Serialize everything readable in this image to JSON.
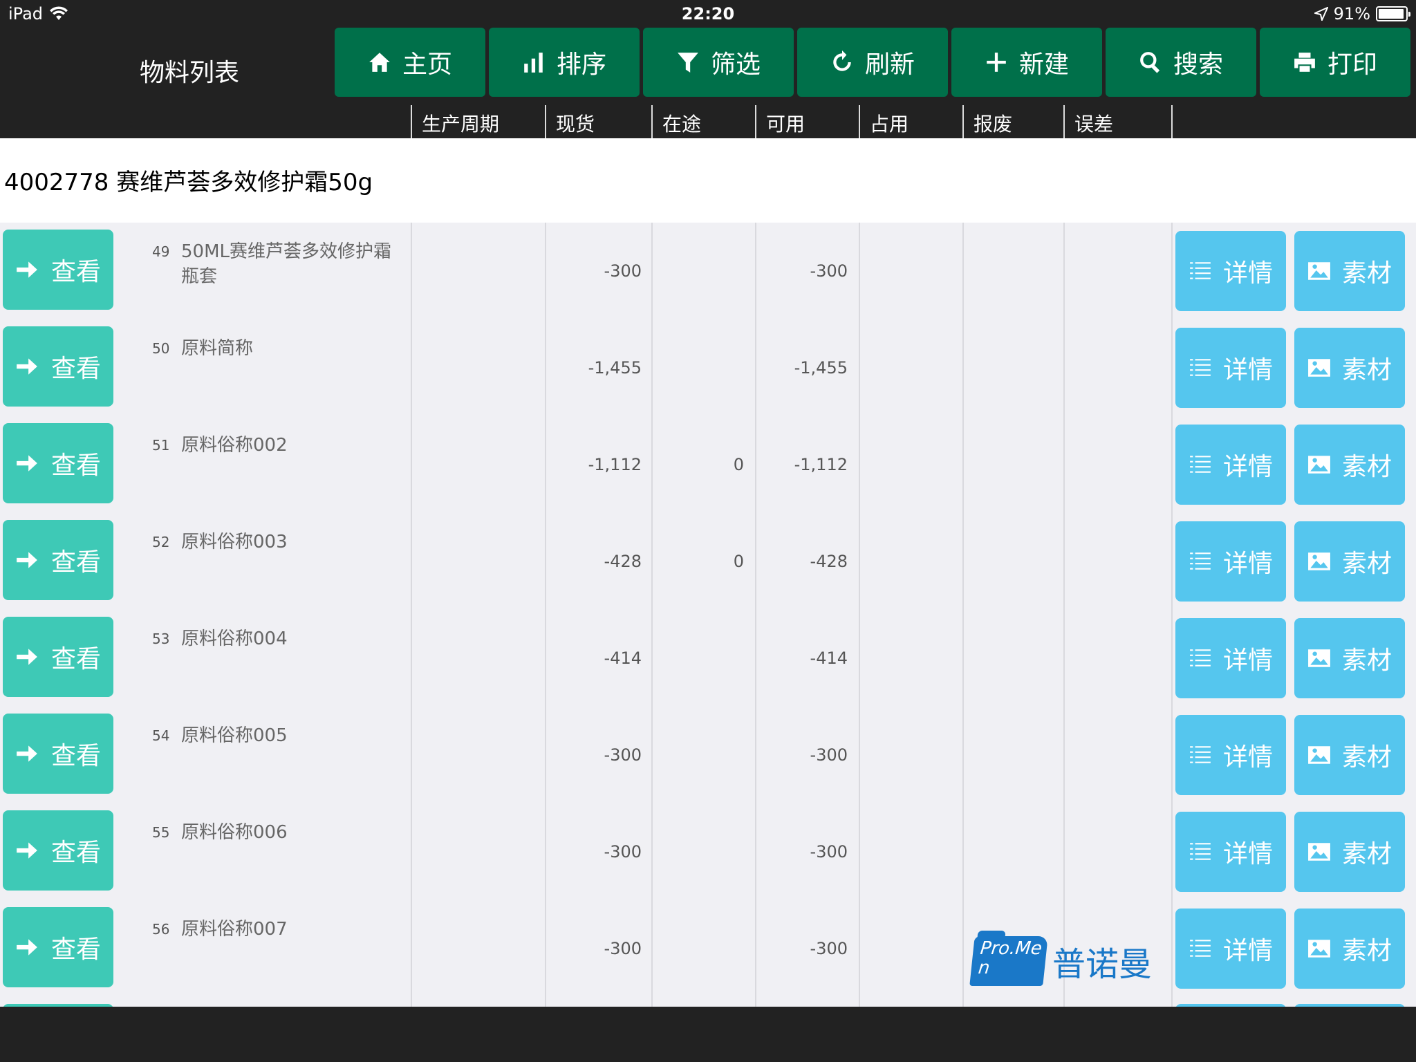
{
  "status_bar": {
    "device": "iPad",
    "time": "22:20",
    "battery": "91%"
  },
  "header": {
    "title": "物料列表"
  },
  "toolbar": {
    "buttons": [
      {
        "label": "主页",
        "icon": "home-icon"
      },
      {
        "label": "排序",
        "icon": "bar-chart-icon"
      },
      {
        "label": "筛选",
        "icon": "filter-icon"
      },
      {
        "label": "刷新",
        "icon": "refresh-icon"
      },
      {
        "label": "新建",
        "icon": "plus-icon"
      },
      {
        "label": "搜索",
        "icon": "search-icon"
      },
      {
        "label": "打印",
        "icon": "print-icon"
      }
    ]
  },
  "columns": [
    "生产周期",
    "现货",
    "在途",
    "可用",
    "占用",
    "报废",
    "误差"
  ],
  "product": {
    "title": "4002778  赛维芦荟多效修护霜50g"
  },
  "actions": {
    "view": "查看",
    "detail": "详情",
    "material": "素材"
  },
  "rows": [
    {
      "num": "49",
      "name": "50ML赛维芦荟多效修护霜瓶套",
      "stock": "-300",
      "transit": "",
      "available": "-300"
    },
    {
      "num": "50",
      "name": "原料简称",
      "stock": "-1,455",
      "transit": "",
      "available": "-1,455"
    },
    {
      "num": "51",
      "name": "原料俗称002",
      "stock": "-1,112",
      "transit": "0",
      "available": "-1,112"
    },
    {
      "num": "52",
      "name": "原料俗称003",
      "stock": "-428",
      "transit": "0",
      "available": "-428"
    },
    {
      "num": "53",
      "name": "原料俗称004",
      "stock": "-414",
      "transit": "",
      "available": "-414"
    },
    {
      "num": "54",
      "name": "原料俗称005",
      "stock": "-300",
      "transit": "",
      "available": "-300"
    },
    {
      "num": "55",
      "name": "原料俗称006",
      "stock": "-300",
      "transit": "",
      "available": "-300"
    },
    {
      "num": "56",
      "name": "原料俗称007",
      "stock": "-300",
      "transit": "",
      "available": "-300"
    }
  ],
  "logo": {
    "text": "Pro.Men",
    "cn": "普诺曼"
  },
  "colors": {
    "toolbar_green": "#00704a",
    "view_teal": "#3ec9b6",
    "action_blue": "#55c6ee",
    "logo_blue": "#1a78c8"
  }
}
